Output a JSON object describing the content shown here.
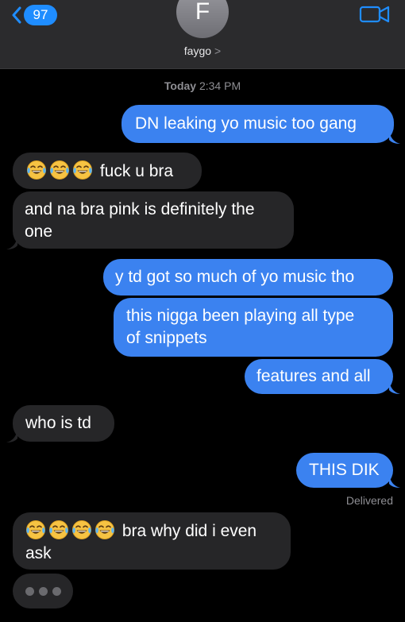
{
  "header": {
    "back_count": "97",
    "avatar_initial": "F",
    "contact_name": "faygo",
    "contact_chevron": ">"
  },
  "timestamp": {
    "day": "Today",
    "time": "2:34 PM"
  },
  "messages": [
    {
      "direction": "sent",
      "text": "DN leaking yo music too gang"
    },
    {
      "direction": "received",
      "emoji_count": 3,
      "emoji": "face-with-tears-of-joy",
      "text": "fuck u bra"
    },
    {
      "direction": "received",
      "line1": "and na bra pink is definitely the",
      "line2": "one"
    },
    {
      "direction": "sent",
      "text": "y td got so much of yo music tho"
    },
    {
      "direction": "sent",
      "line1": "this nigga been playing all type",
      "line2": "of snippets"
    },
    {
      "direction": "sent",
      "text": "features and all"
    },
    {
      "direction": "received",
      "text": "who is td"
    },
    {
      "direction": "sent",
      "text": "THIS DIK"
    },
    {
      "direction": "received",
      "emoji_count": 4,
      "emoji": "face-with-tears-of-joy",
      "line1": "bra why did i even",
      "line2": "ask"
    }
  ],
  "status": {
    "delivered": "Delivered"
  },
  "colors": {
    "sent_bubble": "#3b82f0",
    "received_bubble": "#262628",
    "accent": "#1f8dff"
  }
}
